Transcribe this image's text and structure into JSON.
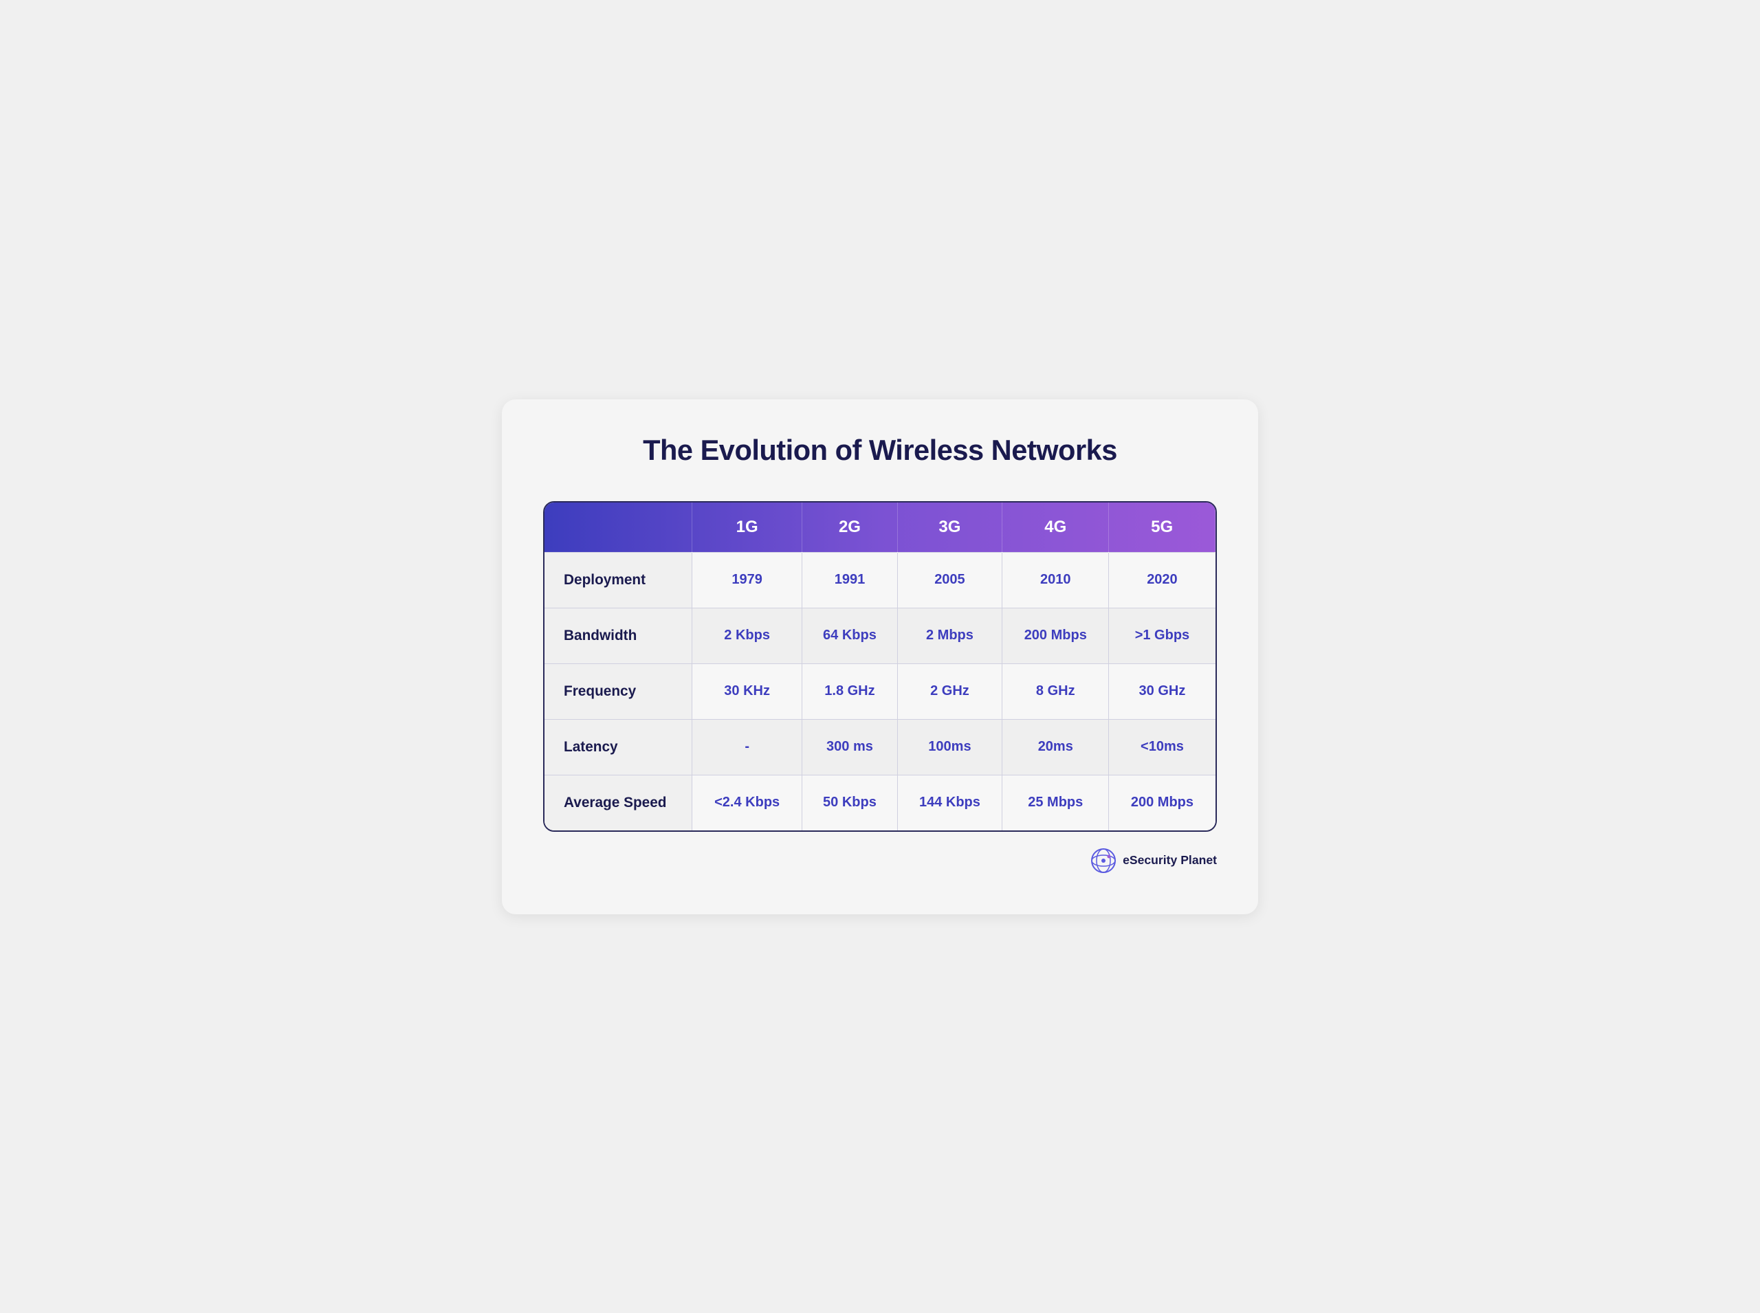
{
  "page": {
    "title": "The Evolution of Wireless Networks",
    "background_color": "#f0f0f0"
  },
  "table": {
    "header": {
      "empty_label": "",
      "columns": [
        "1G",
        "2G",
        "3G",
        "4G",
        "5G"
      ]
    },
    "rows": [
      {
        "label": "Deployment",
        "values": [
          "1979",
          "1991",
          "2005",
          "2010",
          "2020"
        ]
      },
      {
        "label": "Bandwidth",
        "values": [
          "2 Kbps",
          "64 Kbps",
          "2 Mbps",
          "200 Mbps",
          ">1 Gbps"
        ]
      },
      {
        "label": "Frequency",
        "values": [
          "30 KHz",
          "1.8 GHz",
          "2 GHz",
          "8 GHz",
          "30 GHz"
        ]
      },
      {
        "label": "Latency",
        "values": [
          "-",
          "300 ms",
          "100ms",
          "20ms",
          "<10ms"
        ]
      },
      {
        "label": "Average Speed",
        "values": [
          "<2.4 Kbps",
          "50 Kbps",
          "144 Kbps",
          "25 Mbps",
          "200 Mbps"
        ]
      }
    ]
  },
  "footer": {
    "brand_name": "eSecurity Planet"
  }
}
